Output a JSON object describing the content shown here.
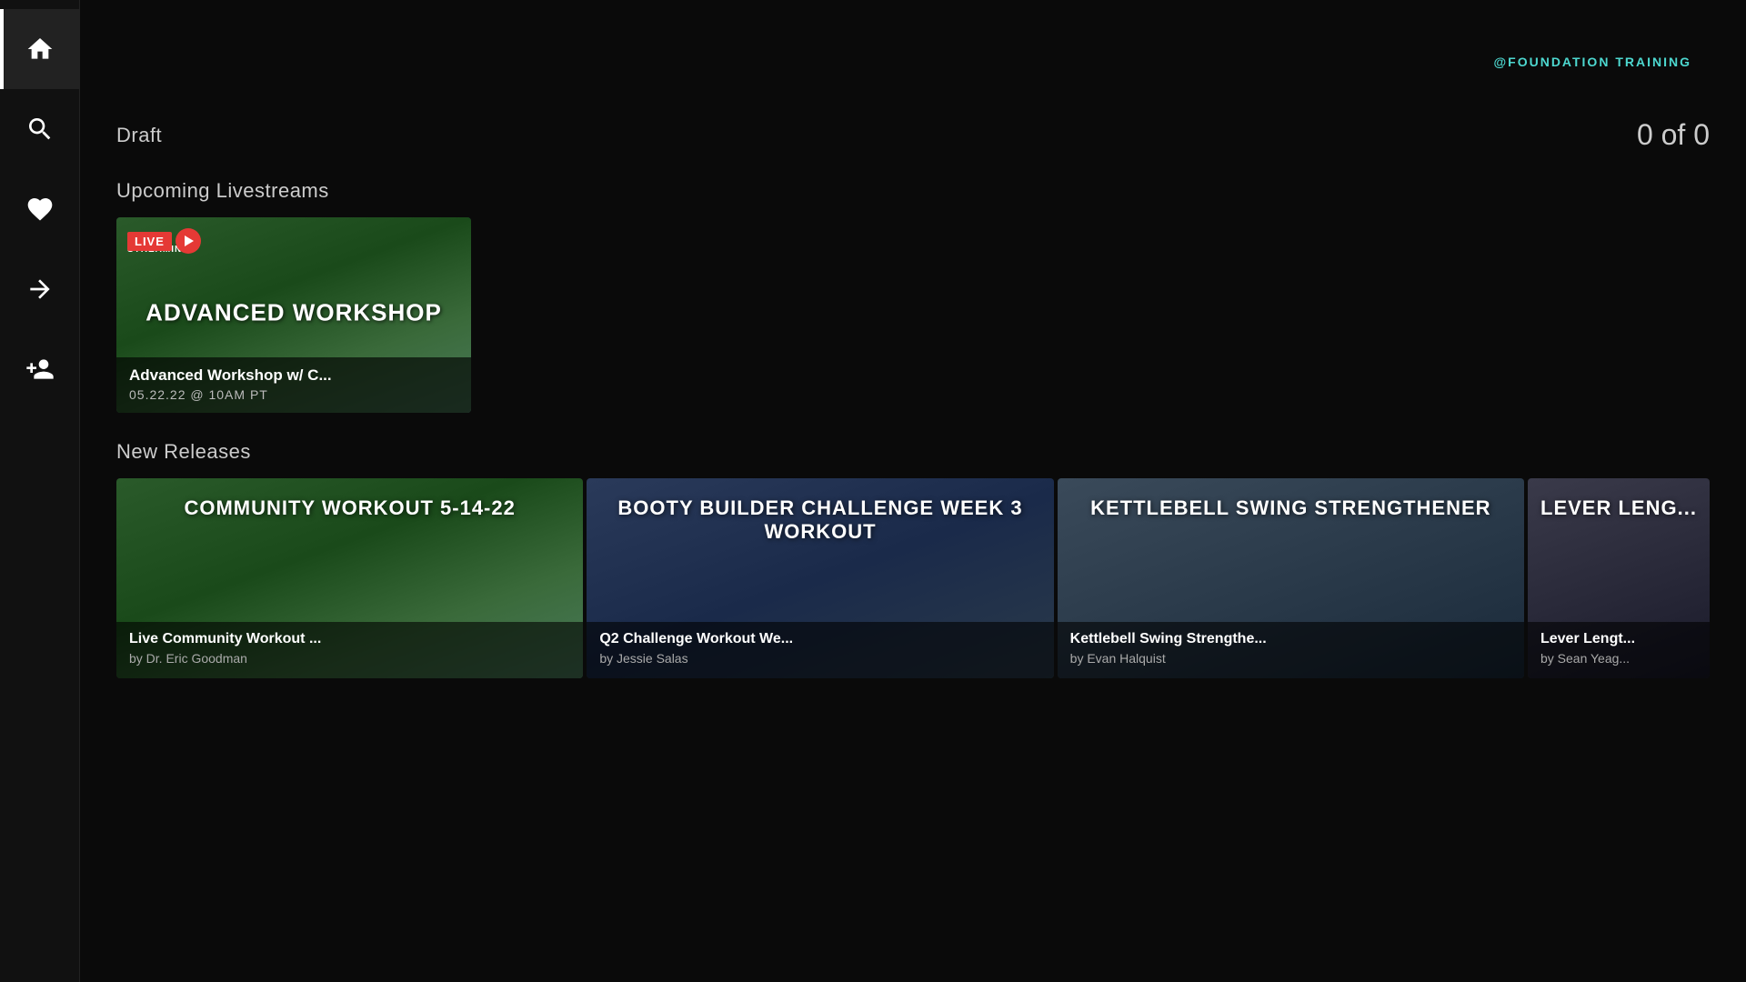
{
  "brand": {
    "logo_text": "@FOUNDATION TRAINING"
  },
  "sidebar": {
    "items": [
      {
        "id": "home",
        "icon": "home",
        "active": true
      },
      {
        "id": "search",
        "icon": "search",
        "active": false
      },
      {
        "id": "favorites",
        "icon": "heart",
        "active": false
      },
      {
        "id": "forward",
        "icon": "arrow-right",
        "active": false
      },
      {
        "id": "add-user",
        "icon": "person-add",
        "active": false
      }
    ]
  },
  "draft": {
    "section_title": "Draft",
    "count_text": "0 of 0"
  },
  "upcoming_livestreams": {
    "section_title": "Upcoming Livestreams",
    "card": {
      "overlay_title": "Advanced Workshop",
      "title": "Advanced Workshop w/ C...",
      "date": "05.22.22 @ 10AM PT",
      "live_label": "LIVE",
      "streaming_label": "STREAMING"
    }
  },
  "new_releases": {
    "section_title": "New Releases",
    "cards": [
      {
        "overlay_title": "Community Workout 5-14-22",
        "title": "Live Community Workout ...",
        "author": "by Dr. Eric Goodman"
      },
      {
        "overlay_title": "Booty Builder Challenge Week 3 Workout",
        "title": "Q2 Challenge Workout We...",
        "author": "by Jessie Salas"
      },
      {
        "overlay_title": "Kettlebell Swing Strengthener",
        "title": "Kettlebell Swing Strengthe...",
        "author": "by Evan Halquist"
      },
      {
        "overlay_title": "Lever Leng...",
        "title": "Lever Lengt...",
        "author": "by Sean Yeag..."
      }
    ]
  }
}
